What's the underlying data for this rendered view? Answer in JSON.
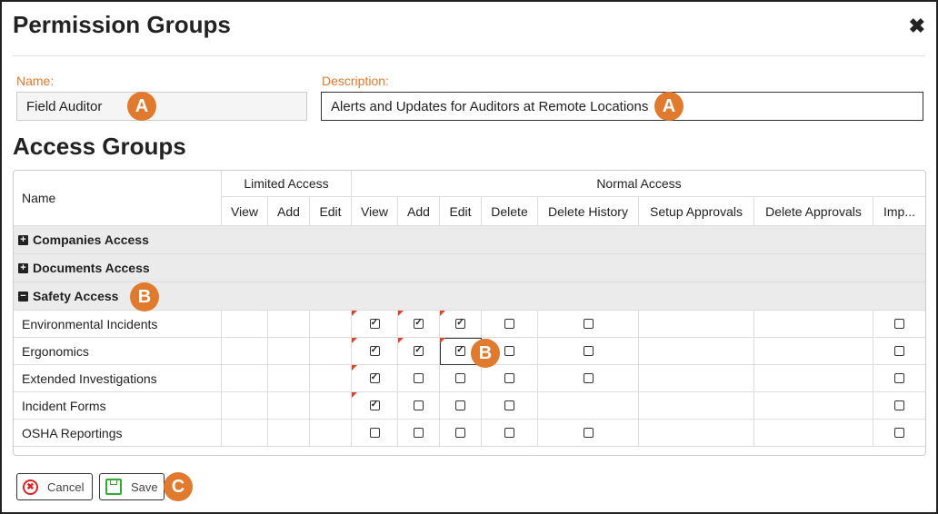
{
  "dialog": {
    "title": "Permission Groups",
    "close_icon": "close-x-icon"
  },
  "form": {
    "name_label": "Name:",
    "name_value": "Field Auditor",
    "description_label": "Description:",
    "description_value": "Alerts and Updates for Auditors at Remote Locations"
  },
  "callouts": {
    "a": "A",
    "b": "B",
    "c": "C",
    "color": "#e07a2e"
  },
  "access": {
    "title": "Access Groups",
    "headers": {
      "name": "Name",
      "limited": "Limited Access",
      "normal": "Normal Access",
      "columns": [
        "View",
        "Add",
        "Edit",
        "View",
        "Add",
        "Edit",
        "Delete",
        "Delete History",
        "Setup Approvals",
        "Delete Approvals",
        "Imp..."
      ]
    },
    "groups": [
      {
        "label": "Companies Access",
        "expanded": false
      },
      {
        "label": "Documents Access",
        "expanded": false
      },
      {
        "label": "Safety Access",
        "expanded": true
      }
    ],
    "rows": [
      {
        "name": "Environmental Incidents",
        "normal": [
          "checked",
          "checked",
          "checked",
          "unchecked",
          "unchecked",
          null,
          null,
          "unchecked"
        ],
        "flags": [
          true,
          true,
          true
        ]
      },
      {
        "name": "Ergonomics",
        "normal": [
          "checked",
          "checked",
          "checked",
          "unchecked",
          "unchecked",
          null,
          null,
          "unchecked"
        ],
        "flags": [
          true,
          true,
          true
        ]
      },
      {
        "name": "Extended Investigations",
        "normal": [
          "checked",
          "unchecked",
          "unchecked",
          "unchecked",
          "unchecked",
          null,
          null,
          "unchecked"
        ],
        "flags": [
          true,
          false,
          false
        ]
      },
      {
        "name": "Incident Forms",
        "normal": [
          "checked",
          "unchecked",
          "unchecked",
          "unchecked",
          null,
          null,
          null,
          "unchecked"
        ],
        "flags": [
          true,
          false,
          false
        ]
      },
      {
        "name": "OSHA Reportings",
        "normal": [
          "unchecked",
          "unchecked",
          "unchecked",
          "unchecked",
          "unchecked",
          null,
          null,
          "unchecked"
        ],
        "flags": [
          false,
          false,
          false
        ]
      }
    ]
  },
  "footer": {
    "cancel": "Cancel",
    "save": "Save"
  }
}
